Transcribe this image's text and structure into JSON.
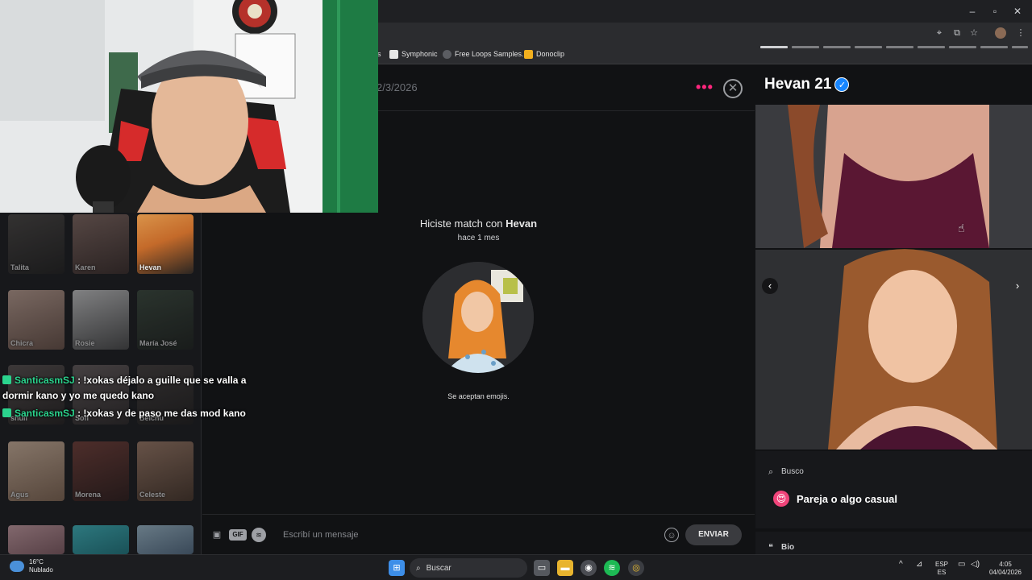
{
  "browser": {
    "bookmarks": [
      {
        "label": "s",
        "icon": "bookmark-fragment-icon"
      },
      {
        "label": "Symphonic",
        "icon": "symphonic-icon"
      },
      {
        "label": "Free Loops Samples...",
        "icon": "freeloops-icon"
      },
      {
        "label": "Donoclip",
        "icon": "donoclip-icon"
      }
    ]
  },
  "sidebar": {
    "matches": [
      {
        "name": "Talita"
      },
      {
        "name": "Karen"
      },
      {
        "name": "Hevan"
      },
      {
        "name": "Chicra"
      },
      {
        "name": "Rosie"
      },
      {
        "name": "María José"
      },
      {
        "name": "shuli"
      },
      {
        "name": "Sofi"
      },
      {
        "name": "Belchu"
      },
      {
        "name": "Agus"
      },
      {
        "name": "Morena"
      },
      {
        "name": "Celeste"
      }
    ]
  },
  "chat": {
    "date": "2/3/2026",
    "match_prefix": "Hiciste match con ",
    "match_name": "Hevan",
    "match_time": "hace 1 mes",
    "emoji_note": "Se aceptan emojis.",
    "input_placeholder": "Escribí un mensaje",
    "send_label": "ENVIAR",
    "gif_label": "GIF"
  },
  "profile": {
    "name_age": "Hevan 21",
    "busco_label": "Busco",
    "busco_value": "Pareja o algo casual",
    "bio_label": "Bio",
    "bio_icon": "quote-icon"
  },
  "stream_chat": [
    {
      "user": "SanticasmSJ",
      "text": ": !xokas déjalo a guille que se valla a",
      "cont": "dormir kano y yo me quedo kano"
    },
    {
      "user": "SanticasmSJ",
      "text": ": !xokas y de paso me das mod kano"
    }
  ],
  "taskbar": {
    "temp": "16°C",
    "condition": "Nublado",
    "search_placeholder": "Buscar",
    "lang_top": "ESP",
    "lang_bottom": "ES",
    "time": "4:05",
    "date": "04/04/2026"
  },
  "colors": {
    "accent": "#fd267d",
    "verified": "#1786ff",
    "chat_user": "#2bd48e"
  }
}
